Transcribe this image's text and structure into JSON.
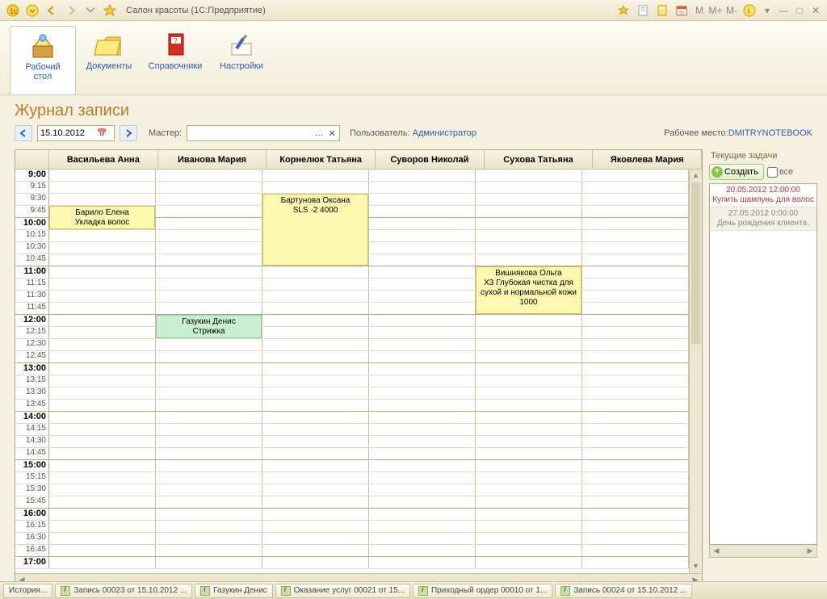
{
  "titlebar": {
    "app_title": "Салон красоты  (1С:Предприятие)",
    "m_buttons": [
      "M",
      "M+",
      "M-"
    ]
  },
  "toolbar": {
    "items": [
      {
        "label": "Рабочий\nстол",
        "active": true
      },
      {
        "label": "Документы"
      },
      {
        "label": "Справочники"
      },
      {
        "label": "Настройки"
      }
    ]
  },
  "page": {
    "heading": "Журнал записи"
  },
  "filter": {
    "date": "15.10.2012",
    "master_label": "Мастер:",
    "user_label": "Пользователь:",
    "user_value": "Администратор",
    "workplace_label": "Рабочее место:",
    "workplace_value": "DMITRYNOTEBOOK"
  },
  "schedule": {
    "columns": [
      "Васильева Анна",
      "Иванова Мария",
      "Корнелюк Татьяна",
      "Суворов Николай",
      "Сухова Татьяна",
      "Яковлева Мария"
    ],
    "time_slots": [
      "9:00",
      "9:15",
      "9:30",
      "9:45",
      "10:00",
      "10:15",
      "10:30",
      "10:45",
      "11:00",
      "11:15",
      "11:30",
      "11:45",
      "12:00",
      "12:15",
      "12:30",
      "12:45",
      "13:00",
      "13:15",
      "13:30",
      "13:45",
      "14:00",
      "14:15",
      "14:30",
      "14:45",
      "15:00",
      "15:15",
      "15:30",
      "15:45",
      "16:00",
      "16:15",
      "16:30",
      "16:45",
      "17:00"
    ],
    "events": [
      {
        "col": 0,
        "start": "9:45",
        "end": "10:00",
        "title": "Барило Елена",
        "detail": "Укладка волос",
        "color": "yellow"
      },
      {
        "col": 2,
        "start": "9:30",
        "end": "10:45",
        "title": "Бартунова Оксана",
        "detail": "SLS -2 4000",
        "color": "yellow"
      },
      {
        "col": 4,
        "start": "11:00",
        "end": "11:45",
        "title": "Вишнякова Ольга",
        "detail": "X3 Глубокая чистка для сухой и нормальной кожи 1000",
        "color": "yellow"
      },
      {
        "col": 1,
        "start": "12:00",
        "end": "12:15",
        "title": "Газукин Денис",
        "detail": "Стрижка",
        "color": "green"
      }
    ]
  },
  "tasks": {
    "title": "Текущие задачи",
    "create_label": "Создать",
    "all_label": "все",
    "items": [
      {
        "dt": "20.05.2012 12:00:00",
        "text": "Купить шампунь для волос",
        "style": "red"
      },
      {
        "dt": "27.05.2012 0:00:00",
        "text": "День рождения клиента.",
        "style": "gray"
      }
    ]
  },
  "bottom_tabs": [
    "История...",
    "Запись 00023 от 15.10.2012 ...",
    "Газукин Денис",
    "Оказание услуг 00021 от 15...",
    "Приходный ордер 00010 от 1...",
    "Запись 00024 от 15.10.2012 ..."
  ]
}
